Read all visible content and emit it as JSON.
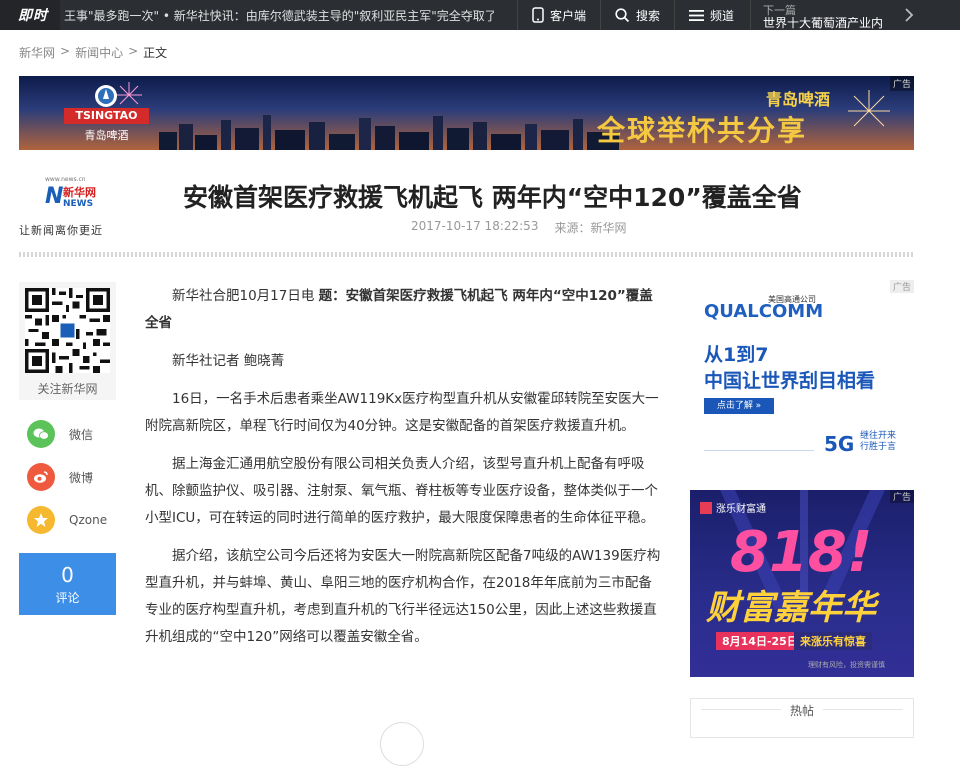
{
  "topbar": {
    "logo": "即时",
    "ticker": "王事\"最多跑一次\"  •  新华社快讯：由库尔德武装主导的\"叙利亚民主军\"完全夺取了",
    "client_label": "客户端",
    "search_label": "搜索",
    "channel_label": "频道",
    "next_label": "下一篇",
    "next_title": "世界十大葡萄酒产业内"
  },
  "breadcrumb": [
    "新华网",
    ">",
    "新闻中心",
    ">",
    "正文"
  ],
  "banner": {
    "logo_en": "TSINGTAO",
    "logo_cn": "青岛啤酒",
    "brand_cn": "青岛啤酒",
    "slogan": "全球举杯共分享",
    "ad_tag": "广告"
  },
  "site_logo": {
    "url_small": "www.news.cn",
    "brand": "新华网",
    "brand_en": "NEWS",
    "slogan": "让新闻离你更近"
  },
  "article": {
    "title": "安徽首架医疗救援飞机起飞 两年内“空中120”覆盖全省",
    "date": "2017-10-17 18:22:53",
    "source": "来源：新华网",
    "lead_prefix": "新华社合肥10月17日电 ",
    "lead_bold": "题：安徽首架医疗救援飞机起飞 两年内“空中120”覆盖全省",
    "reporter": "新华社记者 鲍晓菁",
    "paragraphs": [
      "16日，一名手术后患者乘坐AW119Kx医疗构型直升机从安徽霍邱转院至安医大一附院高新院区，单程飞行时间仅为40分钟。这是安徽配备的首架医疗救援直升机。",
      "据上海金汇通用航空股份有限公司相关负责人介绍，该型号直升机上配备有呼吸机、除颤监护仪、吸引器、注射泵、氧气瓶、脊柱板等专业医疗设备，整体类似于一个小型ICU，可在转运的同时进行简单的医疗救护，最大限度保障患者的生命体征平稳。",
      "据介绍，该航空公司今后还将为安医大一附院高新院区配备7吨级的AW139医疗构型直升机，并与蚌埠、黄山、阜阳三地的医疗机构合作，在2018年年底前为三市配备专业的医疗构型直升机，考虑到直升机的飞行半径远达150公里，因此上述这些救援直升机组成的“空中120”网络可以覆盖安徽全省。"
    ]
  },
  "share": {
    "qr_label": "关注新华网",
    "items": [
      {
        "label": "微信",
        "icon": "wechat-icon",
        "color": "#5cc25a"
      },
      {
        "label": "微博",
        "icon": "weibo-icon",
        "color": "#ef5a3f"
      },
      {
        "label": "Qzone",
        "icon": "qzone-icon",
        "color": "#f5b82e"
      }
    ],
    "comment_count": "0",
    "comment_label": "评论"
  },
  "ad_qualcomm": {
    "tag": "广告",
    "small": "美国高通公司",
    "brand": "QUALCOMM",
    "line1": "从1到7",
    "line2": "中国让世界刮目相看",
    "button": "点击了解 »",
    "fiveg": "5G",
    "fiveg_sub": "继往开来 行胜于言"
  },
  "ad_zhangle": {
    "tag": "广告",
    "brand": "涨乐财富通",
    "big": "818!",
    "headline": "财富嘉年华",
    "date": "8月14日-25日",
    "date2": "来涨乐有惊喜",
    "fine": "理财有风险，投资需谨慎"
  },
  "hot": {
    "title": "热帖"
  }
}
